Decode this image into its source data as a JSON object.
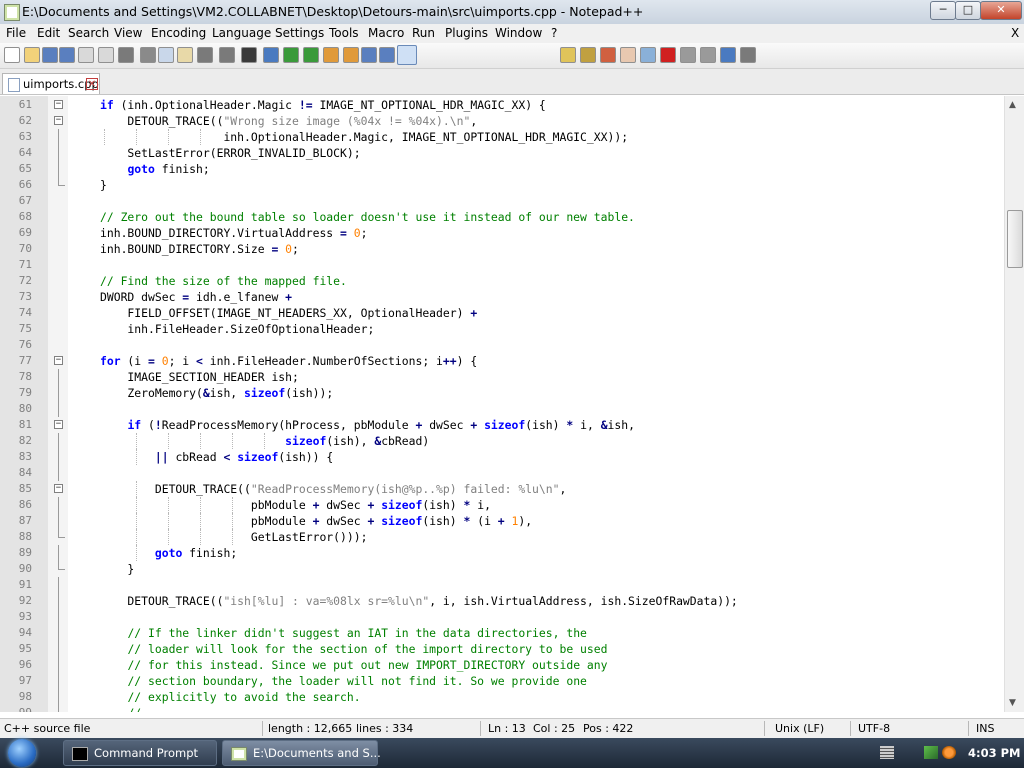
{
  "window": {
    "title": "E:\\Documents and Settings\\VM2.COLLABNET\\Desktop\\Detours-main\\src\\uimports.cpp - Notepad++",
    "controls": {
      "minimize": "─",
      "maximize": "□",
      "close": "✕"
    }
  },
  "menu": {
    "items": [
      "File",
      "Edit",
      "Search",
      "View",
      "Encoding",
      "Language",
      "Settings",
      "Tools",
      "Macro",
      "Run",
      "Plugins",
      "Window",
      "?"
    ],
    "close": "X"
  },
  "toolbar": {
    "buttons": [
      "new-file-icon",
      "open-file-icon",
      "save-icon",
      "save-all-icon",
      "close-icon",
      "close-all-icon",
      "print-icon",
      "cut-icon",
      "copy-icon",
      "paste-icon",
      "undo-icon",
      "redo-icon",
      "find-icon",
      "replace-icon",
      "zoom-in-icon",
      "zoom-out-icon",
      "sync-vertical-icon",
      "sync-horizontal-icon",
      "word-wrap-icon",
      "show-all-chars-icon",
      "indent-guide-icon",
      "udl-icon",
      "doc-map-icon",
      "function-list-icon",
      "folder-workspace-icon",
      "monitoring-icon",
      "record-macro-icon",
      "stop-record-icon",
      "play-macro-icon",
      "run-macro-multiple-icon",
      "save-macro-icon"
    ],
    "active": "indent-guide-icon"
  },
  "tabs": [
    {
      "label": "uimports.cpp",
      "close": "✕"
    }
  ],
  "editor": {
    "lines": [
      {
        "n": "61",
        "fold": "open",
        "guides": [],
        "html": "<span class=\"kw\">if</span> (inh.OptionalHeader.Magic <span class=\"op\">!=</span> IMAGE_NT_OPTIONAL_HDR_MAGIC_XX) {"
      },
      {
        "n": "62",
        "fold": "open",
        "guides": [],
        "html": "    DETOUR_TRACE((<span class=\"st\">\"Wrong size image (%04x != %04x).\\n\"</span>,"
      },
      {
        "n": "63",
        "fold": "line",
        "guides": [
          104,
          136,
          168,
          200
        ],
        "html": "                  inh.OptionalHeader.Magic, IMAGE_NT_OPTIONAL_HDR_MAGIC_XX));"
      },
      {
        "n": "64",
        "fold": "line",
        "guides": [],
        "html": "    SetLastError(ERROR_INVALID_BLOCK);"
      },
      {
        "n": "65",
        "fold": "line",
        "guides": [],
        "html": "    <span class=\"kw\">goto</span> finish;"
      },
      {
        "n": "66",
        "fold": "end",
        "guides": [],
        "html": "}"
      },
      {
        "n": "67",
        "fold": "none",
        "guides": [],
        "html": ""
      },
      {
        "n": "68",
        "fold": "none",
        "guides": [],
        "html": "<span class=\"cm\">// Zero out the bound table so loader doesn't use it instead of our new table.</span>"
      },
      {
        "n": "69",
        "fold": "none",
        "guides": [],
        "html": "inh.BOUND_DIRECTORY.VirtualAddress <span class=\"op\">=</span> <span class=\"nm\">0</span>;"
      },
      {
        "n": "70",
        "fold": "none",
        "guides": [],
        "html": "inh.BOUND_DIRECTORY.Size <span class=\"op\">=</span> <span class=\"nm\">0</span>;"
      },
      {
        "n": "71",
        "fold": "none",
        "guides": [],
        "html": ""
      },
      {
        "n": "72",
        "fold": "none",
        "guides": [],
        "html": "<span class=\"cm\">// Find the size of the mapped file.</span>"
      },
      {
        "n": "73",
        "fold": "none",
        "guides": [],
        "html": "DWORD dwSec <span class=\"op\">=</span> idh.e_lfanew <span class=\"op\">+</span>"
      },
      {
        "n": "74",
        "fold": "none",
        "guides": [],
        "html": "    FIELD_OFFSET(IMAGE_NT_HEADERS_XX, OptionalHeader) <span class=\"op\">+</span>"
      },
      {
        "n": "75",
        "fold": "none",
        "guides": [],
        "html": "    inh.FileHeader.SizeOfOptionalHeader;"
      },
      {
        "n": "76",
        "fold": "none",
        "guides": [],
        "html": ""
      },
      {
        "n": "77",
        "fold": "open",
        "guides": [],
        "html": "<span class=\"kw\">for</span> (i <span class=\"op\">=</span> <span class=\"nm\">0</span>; i <span class=\"op\">&lt;</span> inh.FileHeader.NumberOfSections; i<span class=\"op\">++</span>) {"
      },
      {
        "n": "78",
        "fold": "line",
        "guides": [],
        "html": "    IMAGE_SECTION_HEADER ish;"
      },
      {
        "n": "79",
        "fold": "line",
        "guides": [],
        "html": "    ZeroMemory(<span class=\"op\">&amp;</span>ish, <span class=\"kw\">sizeof</span>(ish));"
      },
      {
        "n": "80",
        "fold": "line",
        "guides": [],
        "html": ""
      },
      {
        "n": "81",
        "fold": "open",
        "guides": [],
        "html": "    <span class=\"kw\">if</span> (<span class=\"op\">!</span>ReadProcessMemory(hProcess, pbModule <span class=\"op\">+</span> dwSec <span class=\"op\">+</span> <span class=\"kw\">sizeof</span>(ish) <span class=\"op\">*</span> i, <span class=\"op\">&amp;</span>ish,"
      },
      {
        "n": "82",
        "fold": "line",
        "guides": [
          136,
          168,
          200,
          232,
          264
        ],
        "html": "                           <span class=\"kw\">sizeof</span>(ish), <span class=\"op\">&amp;</span>cbRead)"
      },
      {
        "n": "83",
        "fold": "line",
        "guides": [
          136
        ],
        "html": "        <span class=\"op\">||</span> cbRead <span class=\"op\">&lt;</span> <span class=\"kw\">sizeof</span>(ish)) {"
      },
      {
        "n": "84",
        "fold": "line",
        "guides": [],
        "html": ""
      },
      {
        "n": "85",
        "fold": "open",
        "guides": [
          136
        ],
        "html": "        DETOUR_TRACE((<span class=\"st\">\"ReadProcessMemory(ish@%p..%p) failed: %lu\\n\"</span>,"
      },
      {
        "n": "86",
        "fold": "line",
        "guides": [
          136,
          168,
          200,
          232
        ],
        "html": "                      pbModule <span class=\"op\">+</span> dwSec <span class=\"op\">+</span> <span class=\"kw\">sizeof</span>(ish) <span class=\"op\">*</span> i,"
      },
      {
        "n": "87",
        "fold": "line",
        "guides": [
          136,
          168,
          200,
          232
        ],
        "html": "                      pbModule <span class=\"op\">+</span> dwSec <span class=\"op\">+</span> <span class=\"kw\">sizeof</span>(ish) <span class=\"op\">*</span> (i <span class=\"op\">+</span> <span class=\"nm\">1</span>),"
      },
      {
        "n": "88",
        "fold": "end",
        "guides": [
          136,
          168,
          200,
          232
        ],
        "html": "                      GetLastError()));"
      },
      {
        "n": "89",
        "fold": "line",
        "guides": [
          136
        ],
        "html": "        <span class=\"kw\">goto</span> finish;"
      },
      {
        "n": "90",
        "fold": "end",
        "guides": [],
        "html": "    }"
      },
      {
        "n": "91",
        "fold": "line",
        "guides": [],
        "html": ""
      },
      {
        "n": "92",
        "fold": "line",
        "guides": [],
        "html": "    DETOUR_TRACE((<span class=\"st\">\"ish[%lu] : va=%08lx sr=%lu\\n\"</span>, i, ish.VirtualAddress, ish.SizeOfRawData));"
      },
      {
        "n": "93",
        "fold": "line",
        "guides": [],
        "html": ""
      },
      {
        "n": "94",
        "fold": "line",
        "guides": [],
        "html": "    <span class=\"cm\">// If the linker didn't suggest an IAT in the data directories, the</span>"
      },
      {
        "n": "95",
        "fold": "line",
        "guides": [],
        "html": "    <span class=\"cm\">// loader will look for the section of the import directory to be used</span>"
      },
      {
        "n": "96",
        "fold": "line",
        "guides": [],
        "html": "    <span class=\"cm\">// for this instead. Since we put out new IMPORT_DIRECTORY outside any</span>"
      },
      {
        "n": "97",
        "fold": "line",
        "guides": [],
        "html": "    <span class=\"cm\">// section boundary, the loader will not find it. So we provide one</span>"
      },
      {
        "n": "98",
        "fold": "line",
        "guides": [],
        "html": "    <span class=\"cm\">// explicitly to avoid the search.</span>"
      },
      {
        "n": "99",
        "fold": "line",
        "guides": [],
        "html": "    <span class=\"cm\">//</span>"
      }
    ]
  },
  "status": {
    "filetype": "C++ source file",
    "length": "length : 12,665",
    "lines": "lines : 334",
    "ln": "Ln : 13",
    "col": "Col : 25",
    "pos": "Pos : 422",
    "eol": "Unix (LF)",
    "encoding": "UTF-8",
    "mode": "INS"
  },
  "taskbar": {
    "items": [
      {
        "label": "Command Prompt"
      },
      {
        "label": "E:\\Documents and S..."
      }
    ],
    "clock": "4:03 PM"
  }
}
